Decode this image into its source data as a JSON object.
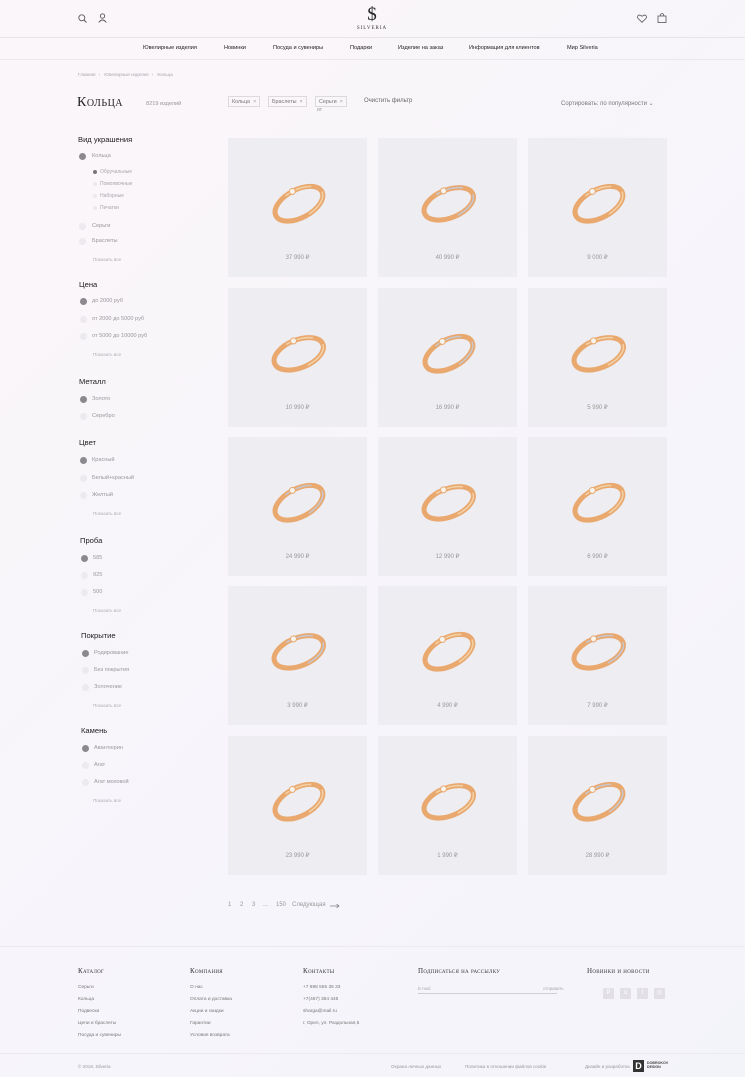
{
  "header": {
    "logo_text": "SILVERIA",
    "nav": [
      "Ювелирные изделия",
      "Новинки",
      "Посуда и сувениры",
      "Подарки",
      "Изделие на заказ",
      "Информация для клиентов",
      "Мир Silveria"
    ]
  },
  "breadcrumb": [
    "Главная",
    "Ювелирные изделия",
    "Кольца"
  ],
  "page": {
    "title": "Кольца",
    "count": "8219 изделий",
    "chips": [
      "Кольца",
      "Браслеты",
      "Серьги"
    ],
    "chip_overflow": "ит",
    "clear_filter": "Очистить фильтр",
    "sort": "Сортировать: по популярности"
  },
  "filters": {
    "type": {
      "title": "Вид украшения",
      "rings": "Кольца",
      "sub": [
        "Обручальные",
        "Помолвочные",
        "Наборные",
        "Печатки"
      ],
      "others": [
        "Серьги",
        "Браслеты"
      ],
      "more": "Показать все"
    },
    "price": {
      "title": "Цена",
      "options": [
        "до 2000 руб",
        "от 2000 до 5000 руб",
        "от 5000 до 10000 руб"
      ],
      "more": "Показать все"
    },
    "metal": {
      "title": "Металл",
      "options": [
        "Золото",
        "Серебро"
      ]
    },
    "color": {
      "title": "Цвет",
      "options": [
        "Красный",
        "Белый+красный",
        "Желтый"
      ],
      "more": "Показать все"
    },
    "probe": {
      "title": "Проба",
      "options": [
        "585",
        "925",
        "500"
      ],
      "more": "Показать все"
    },
    "coating": {
      "title": "Покрытие",
      "options": [
        "Родирование",
        "Без покрытия",
        "Золочение"
      ],
      "more": "Показать все"
    },
    "stone": {
      "title": "Камень",
      "options": [
        "Авантюрин",
        "Агат",
        "Агат моховой"
      ],
      "more": "Показать все"
    }
  },
  "products": [
    {
      "price": "37 990 ₽"
    },
    {
      "price": "40 990 ₽"
    },
    {
      "price": "9 000 ₽"
    },
    {
      "price": "10 990 ₽"
    },
    {
      "price": "16 990 ₽"
    },
    {
      "price": "5 990 ₽"
    },
    {
      "price": "24 990 ₽"
    },
    {
      "price": "12 990 ₽"
    },
    {
      "price": "6 990 ₽"
    },
    {
      "price": "3 990 ₽"
    },
    {
      "price": "4 990 ₽"
    },
    {
      "price": "7 990 ₽"
    },
    {
      "price": "23 990 ₽"
    },
    {
      "price": "1 990 ₽"
    },
    {
      "price": "28 990 ₽"
    }
  ],
  "pagination": {
    "pages": [
      "1",
      "2",
      "3"
    ],
    "ellipsis": "...",
    "last": "150",
    "next": "Следующая"
  },
  "footer": {
    "catalog": {
      "title": "Каталог",
      "links": [
        "Серьги",
        "Кольца",
        "Подвески",
        "Цепи и браслеты",
        "Посуда и сувениры"
      ]
    },
    "company": {
      "title": "Компания",
      "links": [
        "О нас",
        "Оплата и доставка",
        "Акции и скидки",
        "Гарантии",
        "Условия возврата"
      ]
    },
    "contacts": {
      "title": "Контакты",
      "links": [
        "+7 888 555 35 33",
        "+7(467) 384 445",
        "sharga@mail.ru",
        "г. Орел, ул. Раздольная,5"
      ]
    },
    "subscribe": {
      "title": "Подписаться на рассылку",
      "placeholder": "E-mail",
      "button": "отправить"
    },
    "news": {
      "title": "Новинки и новости"
    },
    "copyright": "© 2018, Silveria",
    "privacy": "Охрана личных данных",
    "cookies": "Политика в отношении файлов cookie",
    "design": "Дизайн и разработка",
    "dev_logo": "D",
    "dev_name": [
      "DOBROKOV",
      "DESIGN"
    ]
  },
  "colors": {
    "card_bg": "#eeedf1",
    "gold": "#e9a86e",
    "silver": "#c8c6cc",
    "accent": "#222222"
  }
}
